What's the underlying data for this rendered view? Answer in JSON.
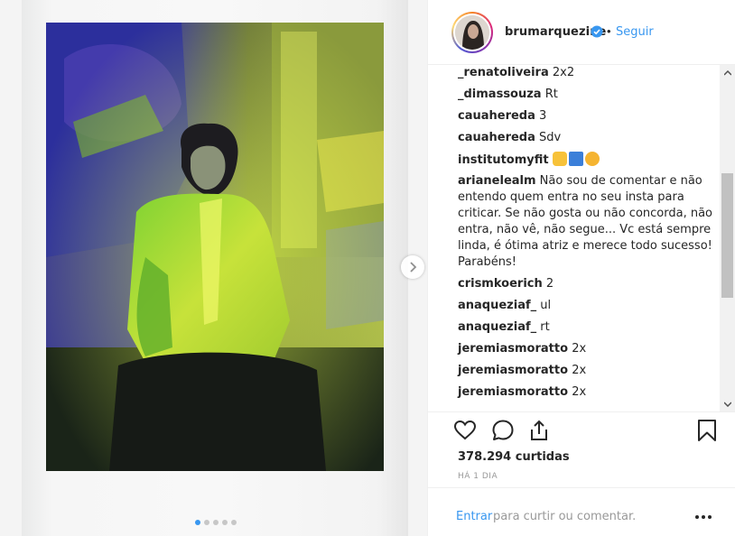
{
  "post": {
    "username": "brumarquezine",
    "separator": "•",
    "follow_label": "Seguir",
    "likes_label": "378.294 curtidas",
    "time_label": "HÁ 1 DIA",
    "carousel_dots": 5,
    "carousel_active": 0
  },
  "comments": [
    {
      "user": "_renatoliveira",
      "text": "2x2"
    },
    {
      "user": "_dimassouza",
      "text": "Rt"
    },
    {
      "user": "cauahereda",
      "text": "3"
    },
    {
      "user": "cauahereda",
      "text": "Sdv"
    },
    {
      "user": "institutomyfit",
      "text": "",
      "emojis": [
        "clap-emoji",
        "top-emoji",
        "heart-eyes-emoji"
      ]
    },
    {
      "user": "arianelealm",
      "text": "Não sou de comentar e não entendo quem entra no seu insta para criticar. Se não gosta ou não concorda, não entra, não vê, não segue... Vc está sempre linda, é ótima atriz e merece todo sucesso! Parabéns!"
    },
    {
      "user": "crismkoerich",
      "text": "2"
    },
    {
      "user": "anaqueziaf_",
      "text": "ul"
    },
    {
      "user": "anaqueziaf_",
      "text": "rt"
    },
    {
      "user": "jeremiasmoratto",
      "text": "2x"
    },
    {
      "user": "jeremiasmoratto",
      "text": "2x"
    },
    {
      "user": "jeremiasmoratto",
      "text": "2x"
    }
  ],
  "footer": {
    "login_link": "Entrar",
    "login_rest": "para curtir ou comentar."
  },
  "icons": {
    "verified": "verified-badge-icon",
    "like": "heart-icon",
    "comment": "comment-bubble-icon",
    "share": "share-icon",
    "save": "bookmark-icon",
    "next": "chevron-right-icon",
    "more": "more-options-icon"
  },
  "colors": {
    "link": "#3897f0",
    "text": "#262626",
    "muted": "#999999"
  }
}
